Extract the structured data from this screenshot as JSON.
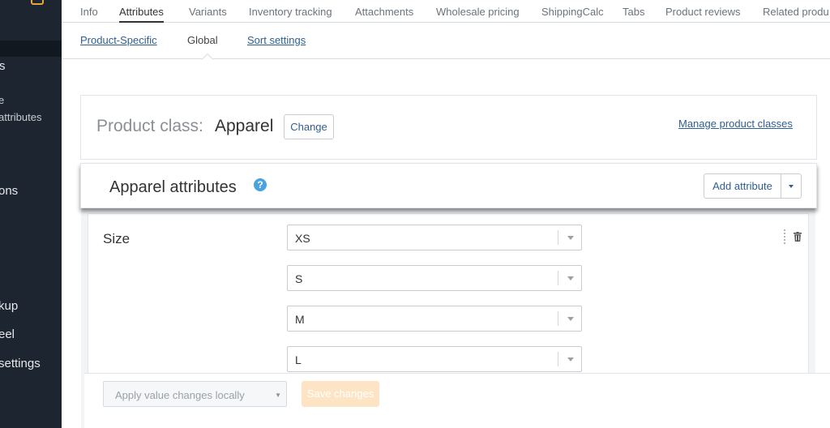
{
  "sidebar": {
    "items": [
      {
        "label": "s"
      },
      {
        "label": "e"
      },
      {
        "label": "attributes"
      },
      {
        "label": "ons"
      },
      {
        "label": "kup"
      },
      {
        "label": "eel"
      },
      {
        "label": "settings"
      }
    ]
  },
  "tabs": [
    "Info",
    "Attributes",
    "Variants",
    "Inventory tracking",
    "Attachments",
    "Wholesale pricing",
    "ShippingCalc",
    "Tabs",
    "Product reviews",
    "Related produ"
  ],
  "subtabs": [
    "Product-Specific",
    "Global",
    "Sort settings"
  ],
  "product_class": {
    "label": "Product class:",
    "value": "Apparel",
    "change_label": "Change",
    "manage_link": "Manage product classes"
  },
  "attributes_section": {
    "title": "Apparel attributes",
    "help_icon": "?",
    "add_label": "Add attribute"
  },
  "attribute": {
    "name": "Size",
    "values": [
      "XS",
      "S",
      "M",
      "L"
    ]
  },
  "save_bar": {
    "apply_label": "Apply value changes locally",
    "save_label": "Save changes"
  },
  "colors": {
    "sidebar_bg": "#1d2530",
    "link": "#2f5e8f",
    "help": "#4aa3df",
    "save_disabled": "#fde4c4"
  }
}
